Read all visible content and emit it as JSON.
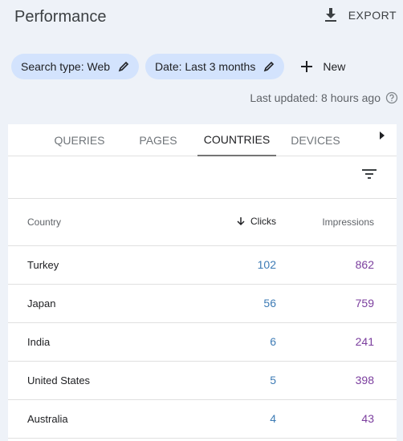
{
  "header": {
    "title": "Performance",
    "export_label": "EXPORT"
  },
  "filters": {
    "chips": [
      {
        "label": "Search type: Web"
      },
      {
        "label": "Date: Last 3 months"
      }
    ],
    "new_label": "New"
  },
  "status": {
    "last_updated": "Last updated: 8 hours ago"
  },
  "tabs": [
    {
      "label": "QUERIES",
      "active": false
    },
    {
      "label": "PAGES",
      "active": false
    },
    {
      "label": "COUNTRIES",
      "active": true
    },
    {
      "label": "DEVICES",
      "active": false
    }
  ],
  "table": {
    "columns": {
      "country": "Country",
      "clicks": "Clicks",
      "impressions": "Impressions"
    },
    "sort_column": "clicks",
    "sort_direction": "desc",
    "rows": [
      {
        "country": "Turkey",
        "clicks": "102",
        "impressions": "862"
      },
      {
        "country": "Japan",
        "clicks": "56",
        "impressions": "759"
      },
      {
        "country": "India",
        "clicks": "6",
        "impressions": "241"
      },
      {
        "country": "United States",
        "clicks": "5",
        "impressions": "398"
      },
      {
        "country": "Australia",
        "clicks": "4",
        "impressions": "43"
      }
    ]
  },
  "colors": {
    "background": "#eef2f8",
    "chip": "#d3e3fd",
    "clicks": "#3d7bb5",
    "impressions": "#7b3e9e"
  }
}
